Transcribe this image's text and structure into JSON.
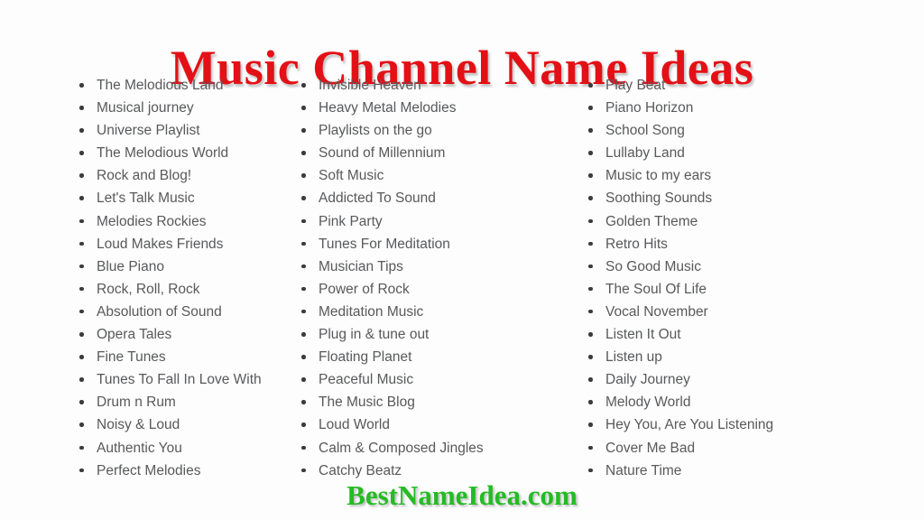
{
  "page": {
    "title": "Music Channel Name Ideas",
    "watermark": "BestNameIdea.com",
    "background_color": "#fdfdfd",
    "title_color": "#e31016",
    "watermark_color": "#24bb24",
    "list_text_color": "#58595b",
    "bullet_color": "#3b3b3d"
  },
  "columns": [
    {
      "id": "column-1",
      "items": [
        "The Melodious Land",
        "Musical journey",
        "Universe Playlist",
        "The Melodious World",
        "Rock and Blog!",
        "Let's Talk Music",
        "Melodies Rockies",
        "Loud Makes Friends",
        "Blue Piano",
        "Rock, Roll, Rock",
        "Absolution of Sound",
        "Opera Tales",
        "Fine Tunes",
        "Tunes To Fall In Love With",
        "Drum n Rum",
        "Noisy & Loud",
        "Authentic You",
        "Perfect Melodies"
      ]
    },
    {
      "id": "column-2",
      "items": [
        "Invisible Heaven",
        "Heavy Metal Melodies",
        "Playlists on the go",
        "Sound of Millennium",
        "Soft Music",
        "Addicted To Sound",
        "Pink Party",
        "Tunes For Meditation",
        "Musician Tips",
        "Power of Rock",
        "Meditation Music",
        "Plug in & tune out",
        "Floating Planet",
        "Peaceful Music",
        "The Music Blog",
        "Loud World",
        "Calm & Composed Jingles",
        "Catchy Beatz"
      ]
    },
    {
      "id": "column-3",
      "items": [
        "Play Beat",
        "Piano Horizon",
        "School Song",
        "Lullaby Land",
        "Music to my ears",
        "Soothing Sounds",
        "Golden Theme",
        "Retro Hits",
        "So Good Music",
        "The Soul Of Life",
        "Vocal November",
        "Listen It Out",
        "Listen up",
        "Daily Journey",
        "Melody World",
        "Hey You, Are You Listening",
        "Cover Me Bad",
        "Nature Time"
      ]
    }
  ]
}
